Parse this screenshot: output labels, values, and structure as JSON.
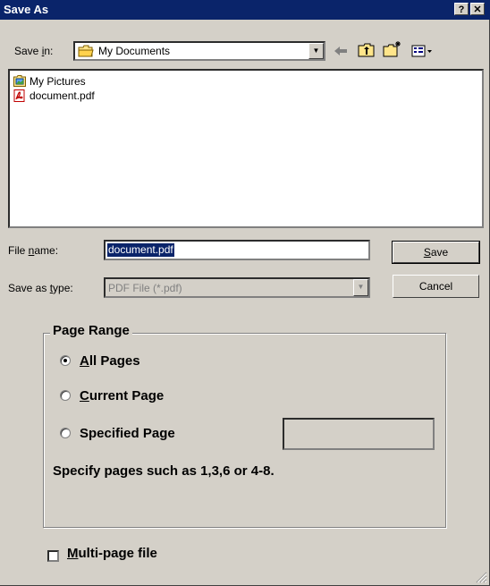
{
  "window": {
    "title": "Save As",
    "help_label": "?",
    "close_label": "✕"
  },
  "save_in": {
    "label_pre": "Save ",
    "label_u": "i",
    "label_post": "n:",
    "value": "My Documents"
  },
  "files": [
    {
      "name": "My Pictures",
      "icon": "pictures-folder-icon"
    },
    {
      "name": "document.pdf",
      "icon": "pdf-file-icon"
    }
  ],
  "file_name": {
    "label_pre": "File ",
    "label_u": "n",
    "label_post": "ame:",
    "value": "document.pdf"
  },
  "save_as_type": {
    "label_pre": "Save as ",
    "label_u": "t",
    "label_post": "ype:",
    "value": "PDF File (*.pdf)"
  },
  "buttons": {
    "save_u": "S",
    "save_rest": "ave",
    "cancel": "Cancel"
  },
  "page_range": {
    "title": "Page Range",
    "all_u": "A",
    "all_rest": "ll Pages",
    "current_u": "C",
    "current_rest": "urrent Page",
    "specified": "Specified Page",
    "selected": "all",
    "hint": "Specify pages such as 1,3,6 or 4-8."
  },
  "multipage": {
    "u": "M",
    "rest": "ulti-page file",
    "checked": false
  }
}
